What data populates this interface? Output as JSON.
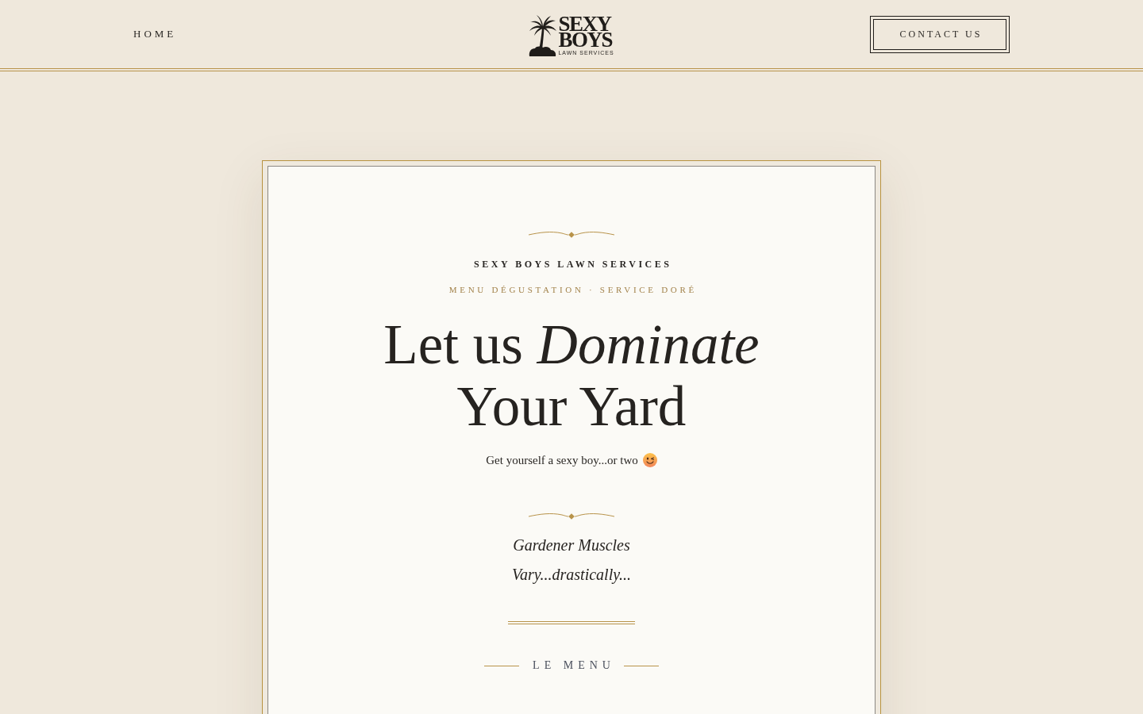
{
  "header": {
    "nav_link": "HOME",
    "logo": {
      "wordmark": [
        "SEXY",
        "BOYS"
      ],
      "tagline": "LAWN SERVICES"
    },
    "button": "CONTACT US"
  },
  "card": {
    "brand": "SEXY BOYS LAWN SERVICES",
    "subtitle": "MENU DÉGUSTATION · SERVICE DORÉ",
    "headline": [
      "Let us *Dominate*",
      "Your Yard"
    ],
    "tagline": "Get yourself a sexy boy...or two",
    "quote": [
      "Gardener Muscles",
      "Vary...drastically..."
    ],
    "section_title": "LE MENU"
  }
}
